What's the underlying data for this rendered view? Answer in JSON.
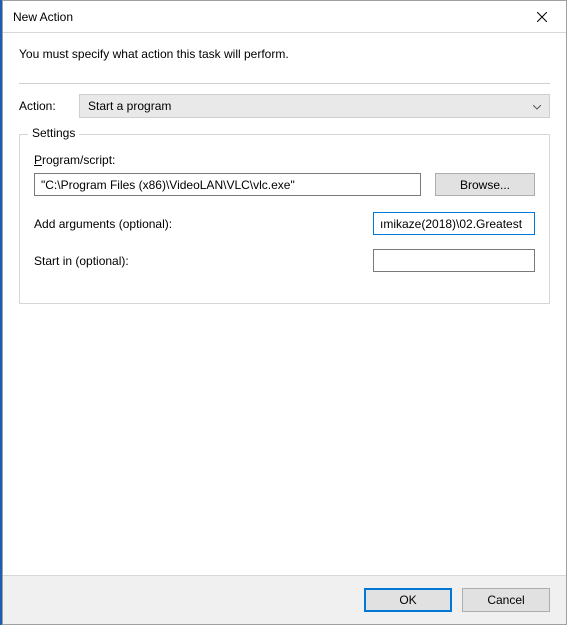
{
  "window": {
    "title": "New Action"
  },
  "instruction": "You must specify what action this task will perform.",
  "action": {
    "label": "Action:",
    "selected": "Start a program"
  },
  "settings": {
    "legend": "Settings",
    "program_label_pre": "P",
    "program_label_post": "rogram/script:",
    "program_value": "\"C:\\Program Files (x86)\\VideoLAN\\VLC\\vlc.exe\"",
    "browse_label": "Browse...",
    "args_label_pre": "A",
    "args_label_post": "dd arguments (optional):",
    "args_value": "ımikaze(2018)\\02.Greatest",
    "start_label_pre": "S",
    "start_label_post": "tart in (optional):",
    "start_value": ""
  },
  "footer": {
    "ok": "OK",
    "cancel": "Cancel"
  }
}
